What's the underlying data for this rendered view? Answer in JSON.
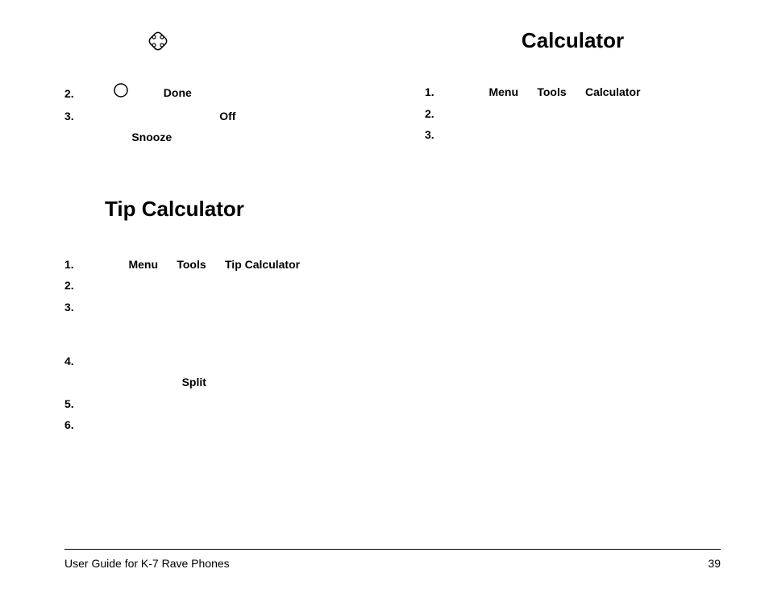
{
  "left": {
    "row2": {
      "num": "2.",
      "done": "Done"
    },
    "row3": {
      "num": "3.",
      "snooze": "Snooze",
      "off": "Off"
    }
  },
  "tip": {
    "heading": "Tip Calculator",
    "row1": {
      "num": "1.",
      "menu": "Menu",
      "tools": "Tools",
      "tipcalc": "Tip Calculator"
    },
    "row2": {
      "num": "2."
    },
    "row3": {
      "num": "3."
    },
    "row4": {
      "num": "4.",
      "split": "Split"
    },
    "row5": {
      "num": "5."
    },
    "row6": {
      "num": "6."
    }
  },
  "right": {
    "heading": "Calculator",
    "row1": {
      "num": "1.",
      "menu": "Menu",
      "tools": "Tools",
      "calc": "Calculator"
    },
    "row2": {
      "num": "2."
    },
    "row3": {
      "num": "3."
    }
  },
  "footer": {
    "left": "User Guide for K-7 Rave Phones",
    "right": "39"
  }
}
